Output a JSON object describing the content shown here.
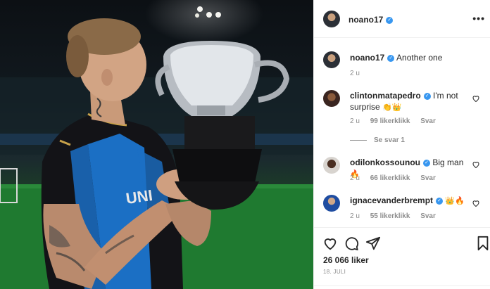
{
  "post": {
    "author": "noano17",
    "caption": "Another one",
    "caption_age": "2 u",
    "likes": "26 066 liker",
    "date": "18. JULI",
    "more_icon": "more-dots-icon"
  },
  "photo": {
    "jersey_text": "UNI"
  },
  "comments": [
    {
      "user": "clintonmatapedro",
      "text": "I'm not surprise",
      "emojis": "👏👑",
      "age": "2 u",
      "likes": "99 likerklikk",
      "reply": "Svar",
      "view_replies": "Se svar 1"
    },
    {
      "user": "odilonkossounou",
      "text": "Big man",
      "emojis": "🔥",
      "age": "2 u",
      "likes": "66 likerklikk",
      "reply": "Svar"
    },
    {
      "user": "ignacevanderbrempt",
      "text": "",
      "emojis": "👑🔥",
      "age": "2 u",
      "likes": "55 likerklikk",
      "reply": "Svar"
    }
  ],
  "colors": {
    "verified": "#3897f0",
    "text": "#262626",
    "muted": "#8e8e8e",
    "jersey_blue": "#1b6fc4"
  },
  "icons": [
    "verified-icon",
    "heart-icon",
    "comment-icon",
    "share-icon",
    "bookmark-icon",
    "more-dots-icon"
  ]
}
